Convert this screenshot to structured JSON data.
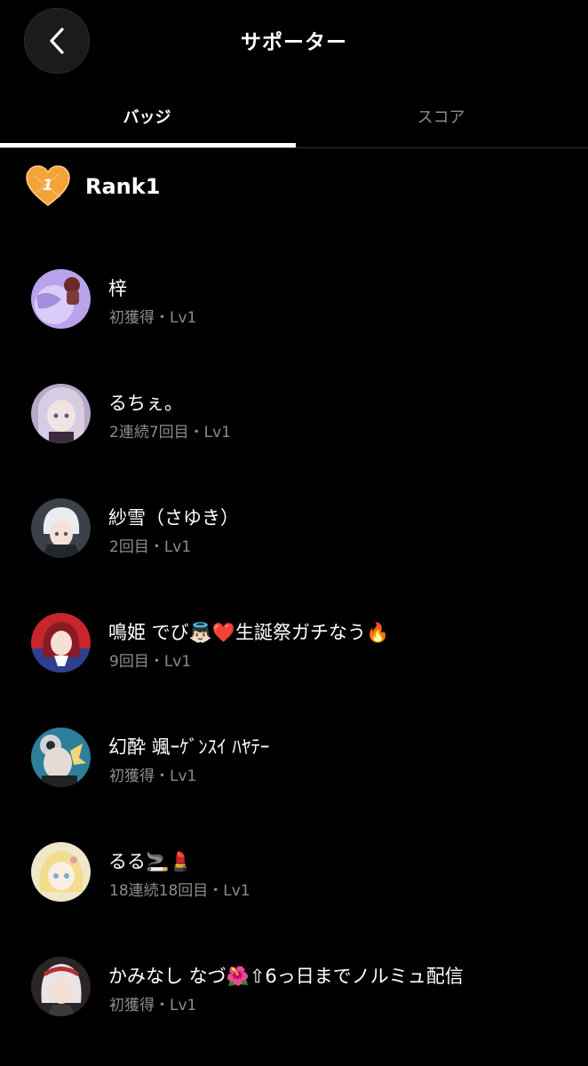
{
  "header": {
    "title": "サポーター",
    "back_icon": "chevron-left-icon"
  },
  "tabs": [
    {
      "label": "バッジ",
      "active": true
    },
    {
      "label": "スコア",
      "active": false
    }
  ],
  "rank": {
    "label": "Rank1",
    "icon": "heart-badge-icon",
    "badge_number": "1",
    "badge_color": "#f4a33a"
  },
  "supporters": [
    {
      "name": "梓",
      "detail": "初獲得・Lv1",
      "avatar_color": "#9f86d8"
    },
    {
      "name": "るちぇ。",
      "detail": "2連続7回目・Lv1",
      "avatar_color": "#8e7aa8"
    },
    {
      "name": "紗雪（さゆき）",
      "detail": "2回目・Lv1",
      "avatar_color": "#5b6670"
    },
    {
      "name": "鳴姫 でび👼🏻❤️生誕祭ガチなう🔥",
      "detail": "9回目・Lv1",
      "avatar_color": "#c5232a"
    },
    {
      "name": "幻酔 颯ｰｹﾞﾝｽｲ ﾊﾔﾃｰ",
      "detail": "初獲得・Lv1",
      "avatar_color": "#3f8fa8"
    },
    {
      "name": "るる🚬💄",
      "detail": "18連続18回目・Lv1",
      "avatar_color": "#e8d89a"
    },
    {
      "name": "かみなし なづ🌺⇧6っ日までノルミュ配信",
      "detail": "初獲得・Lv1",
      "avatar_color": "#3a3234"
    }
  ]
}
